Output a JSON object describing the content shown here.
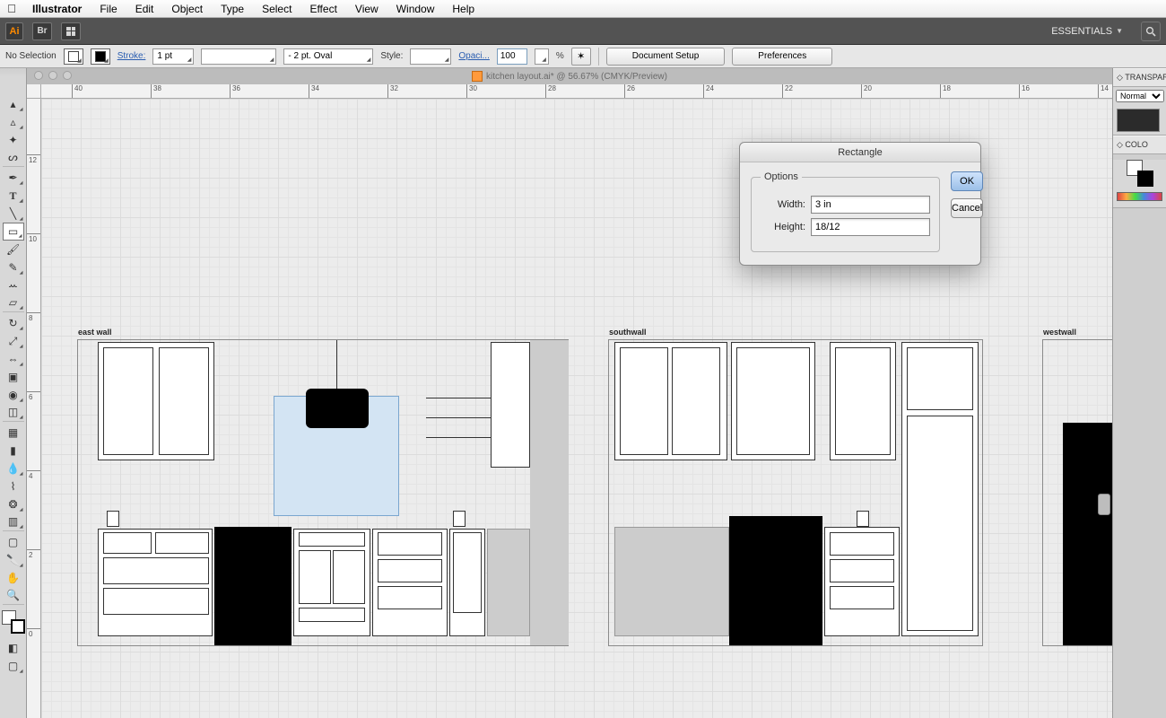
{
  "os_menu": {
    "app_name": "Illustrator",
    "items": [
      "File",
      "Edit",
      "Object",
      "Type",
      "Select",
      "Effect",
      "View",
      "Window",
      "Help"
    ]
  },
  "app_bar": {
    "logo_text": "Ai",
    "workspace_label": "ESSENTIALS"
  },
  "options_bar": {
    "selection_state": "No Selection",
    "stroke_label": "Stroke:",
    "stroke_weight": "1 pt",
    "brush_preset": "- 2 pt. Oval",
    "style_label": "Style:",
    "opacity_label": "Opaci...",
    "opacity_value": "100",
    "percent": "%",
    "btn_doc_setup": "Document Setup",
    "btn_prefs": "Preferences"
  },
  "document": {
    "tab_title": "kitchen layout.ai* @ 56.67% (CMYK/Preview)"
  },
  "ruler": {
    "h_ticks": [
      {
        "pos": 34,
        "label": "40"
      },
      {
        "pos": 122,
        "label": "38"
      },
      {
        "pos": 210,
        "label": "36"
      },
      {
        "pos": 298,
        "label": "34"
      },
      {
        "pos": 386,
        "label": "32"
      },
      {
        "pos": 474,
        "label": "30"
      },
      {
        "pos": 562,
        "label": "28"
      },
      {
        "pos": 650,
        "label": "26"
      },
      {
        "pos": 738,
        "label": "24"
      },
      {
        "pos": 826,
        "label": "22"
      },
      {
        "pos": 914,
        "label": "20"
      },
      {
        "pos": 1002,
        "label": "18"
      },
      {
        "pos": 1090,
        "label": "16"
      },
      {
        "pos": 1178,
        "label": "14"
      }
    ],
    "v_ticks": [
      {
        "pos": 78,
        "label": "12"
      },
      {
        "pos": 166,
        "label": "10"
      },
      {
        "pos": 254,
        "label": "8"
      },
      {
        "pos": 342,
        "label": "6"
      },
      {
        "pos": 430,
        "label": "4"
      },
      {
        "pos": 518,
        "label": "2"
      },
      {
        "pos": 606,
        "label": "0"
      }
    ]
  },
  "artboards": {
    "east": {
      "label": "east wall"
    },
    "south": {
      "label": "southwall"
    },
    "west": {
      "label": "westwall"
    }
  },
  "panels": {
    "transparency": {
      "tab": "TRANSPAREN",
      "mode": "Normal"
    },
    "color": {
      "tab": "COLO"
    }
  },
  "dialog": {
    "title": "Rectangle",
    "group_label": "Options",
    "width_label": "Width:",
    "width_value": "3 in",
    "height_label": "Height:",
    "height_value": "18/12",
    "ok_label": "OK",
    "cancel_label": "Cancel"
  }
}
